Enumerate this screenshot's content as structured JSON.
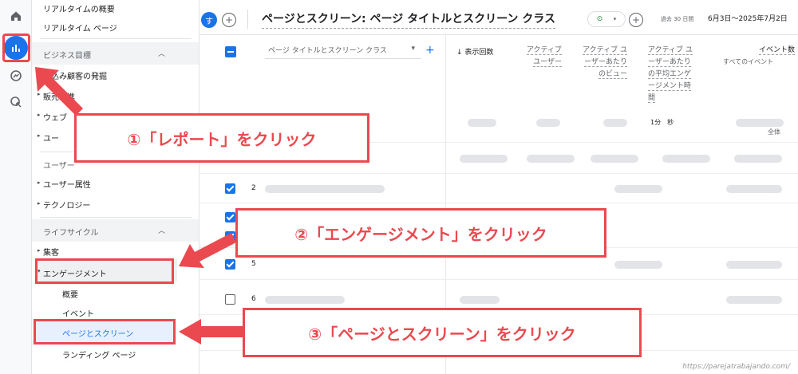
{
  "sidebar": {
    "realtime_overview": "リアルタイムの概要",
    "realtime_pages": "リアルタイム ページ",
    "business_objectives": "ビジネス目標",
    "lead_generation": "見込み顧客の発掘",
    "sales_promotion": "販売促進",
    "website": "ウェブ",
    "user_behavior": "ユー",
    "user_section": "ユーザー",
    "user_attributes": "ユーザー属性",
    "technology": "テクノロジー",
    "lifecycle": "ライフサイクル",
    "acquisition": "集客",
    "engagement": "エンゲージメント",
    "overview": "概要",
    "events": "イベント",
    "pages_and_screens": "ページとスクリーン",
    "landing_page": "ランディング ページ"
  },
  "topbar": {
    "avatar_letter": "す",
    "title": "ページとスクリーン: ページ タイトルとスクリーン クラス",
    "date_label": "過去 30 日間",
    "date_range": "6月3日～2025年7月2日"
  },
  "table": {
    "dimension": "ページ タイトルとスクリーン クラス",
    "views": "表示回数",
    "active_users": "アクティブ ユーザー",
    "views_per_user": "アクティブ ユーザーあたりのビュー",
    "avg_engagement_time": "アクティブ ユーザーあたりの平均エンゲージメント時間",
    "event_count": "イベント数",
    "all_events": "すべてのイベント",
    "engagement_time_value": "1分　秒",
    "total_label": "全体",
    "rows": [
      "2",
      "5",
      "6"
    ]
  },
  "callouts": {
    "step1": "①「レポート」をクリック",
    "step2": "②「エンゲージメント」をクリック",
    "step3": "③「ページとスクリーン」をクリック"
  },
  "watermark": "https://parejatrabajando.com/",
  "colors": {
    "accent": "#1a73e8",
    "callout_red": "#e9494f"
  }
}
